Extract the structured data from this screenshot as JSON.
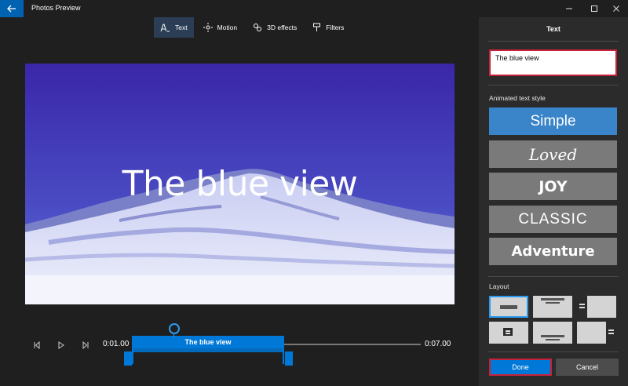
{
  "window": {
    "title": "Photos Preview",
    "controls": [
      "minimize-icon",
      "maximize-icon",
      "close-icon"
    ]
  },
  "toolbar": {
    "items": [
      {
        "label": "Text",
        "icon": "text-icon",
        "active": true
      },
      {
        "label": "Motion",
        "icon": "motion-icon",
        "active": false
      },
      {
        "label": "3D effects",
        "icon": "3d-effects-icon",
        "active": false
      },
      {
        "label": "Filters",
        "icon": "filters-icon",
        "active": false
      }
    ]
  },
  "preview": {
    "overlay_text": "The blue view"
  },
  "timeline": {
    "start_time": "0:01.00",
    "end_time": "0:07.00",
    "clip_label": "The blue view"
  },
  "panel": {
    "title": "Text",
    "text_value": "The blue view",
    "animated_style_label": "Animated text style",
    "styles": [
      "Simple",
      "Loved",
      "JOY",
      "CLASSIC",
      "Adventure"
    ],
    "selected_style": "Simple",
    "layout_label": "Layout",
    "done_label": "Done",
    "cancel_label": "Cancel"
  },
  "colors": {
    "accent": "#0078d7",
    "highlight_border": "#c8223a",
    "panel_bg": "#2b2b2b",
    "app_bg": "#1f1f1f"
  }
}
